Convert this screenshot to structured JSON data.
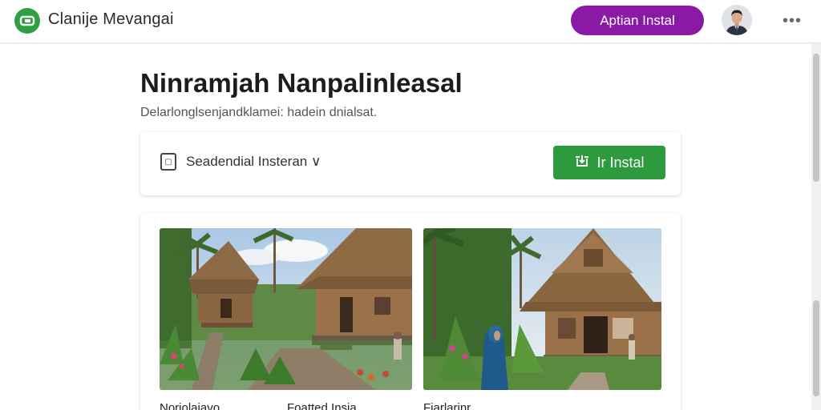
{
  "header": {
    "app_title": "Clanije Mevangai",
    "install_app_label": "Aptian Instal",
    "logo_icon": "app-logo-icon",
    "avatar_icon": "user-avatar",
    "more_label": "•••"
  },
  "main": {
    "title": "Ninramjah Nanpalinleasal",
    "subtitle": "Delarlonglsenjandklamei: hadein dnialsat.",
    "install_card": {
      "select_icon": "device-icon",
      "select_label": "Seadendial Insteran ∨",
      "install_label": "Ir Instal",
      "install_icon": "install-icon"
    },
    "gallery": {
      "captions": [
        "Noriolaiavo",
        "Foatted Insia",
        "Fiarlarinr"
      ]
    }
  },
  "colors": {
    "brand_green": "#2ea043",
    "install_green": "#2d9a3e",
    "accent_purple": "#8a1aa6"
  }
}
